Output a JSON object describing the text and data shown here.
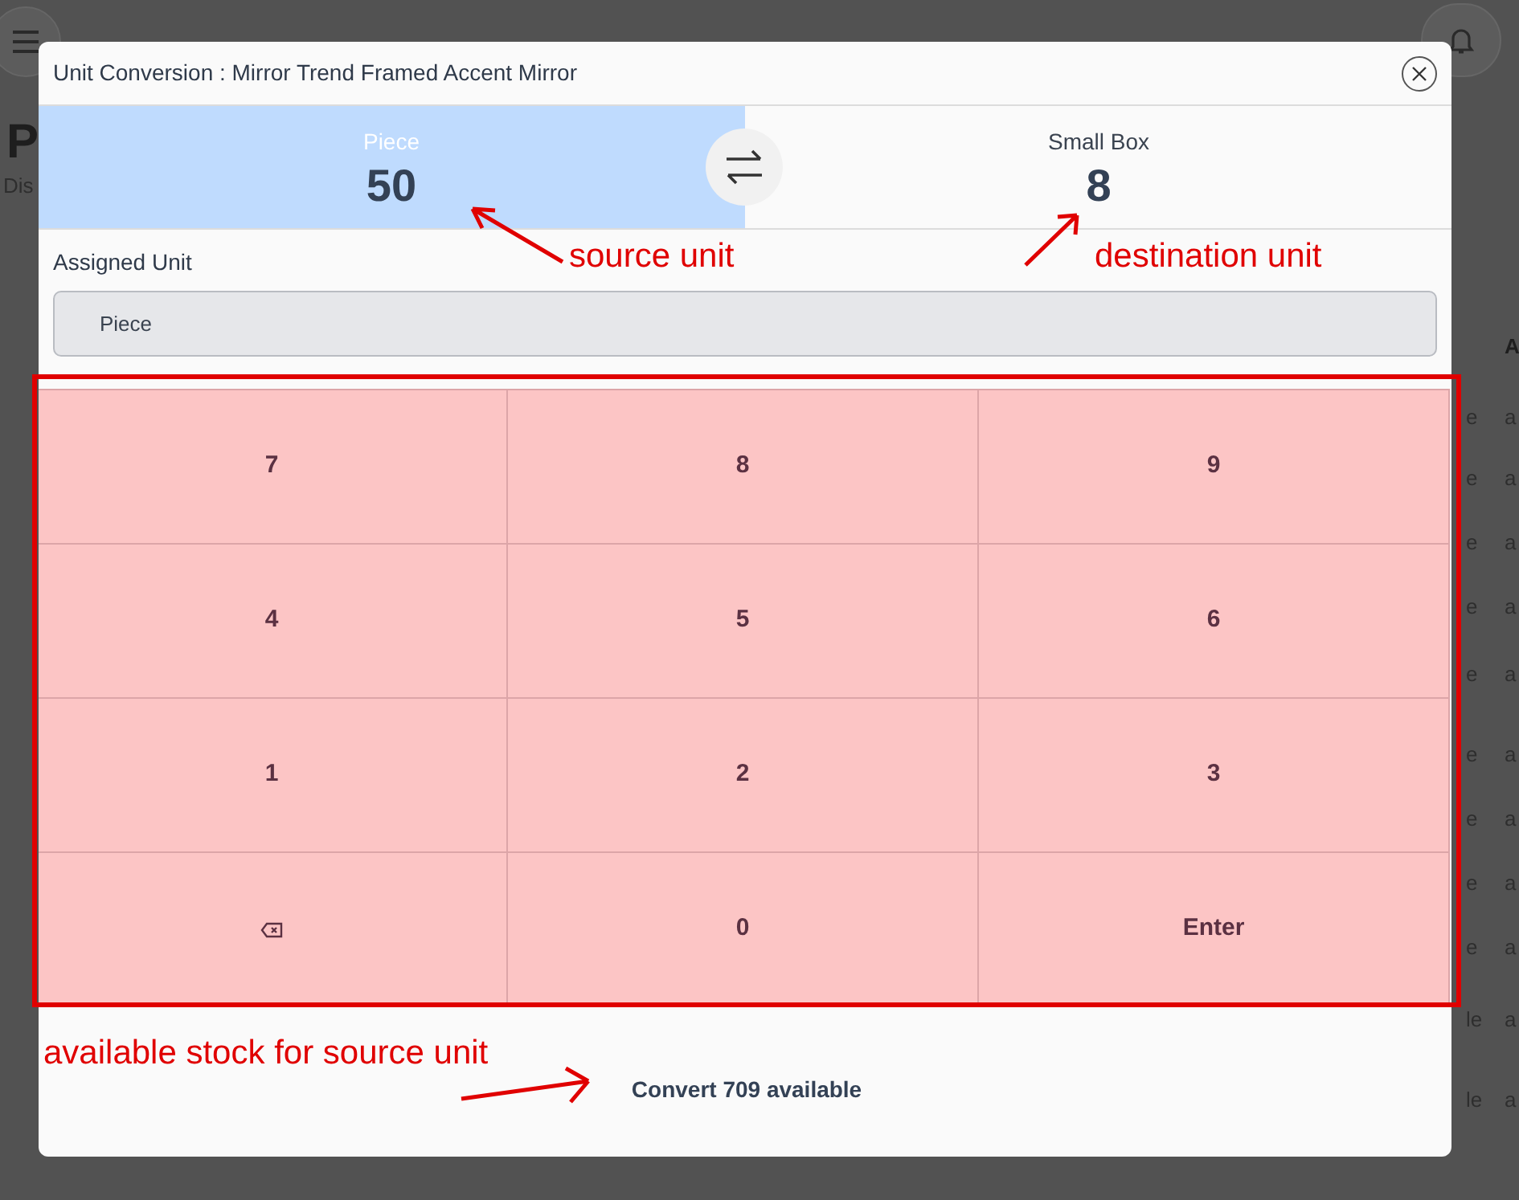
{
  "background_page": {
    "title": "P",
    "subtitle": "Dis",
    "column_header": "A",
    "right_cells": [
      {
        "column_1": "e",
        "column_2": "a"
      },
      {
        "column_1": "e",
        "column_2": "a"
      },
      {
        "column_1": "e",
        "column_2": "a"
      },
      {
        "column_1": "e",
        "column_2": "a"
      },
      {
        "column_1": "e",
        "column_2": "a"
      },
      {
        "column_1": "e",
        "column_2": "a"
      },
      {
        "column_1": "e",
        "column_2": "a"
      },
      {
        "column_1": "e",
        "column_2": "a"
      },
      {
        "column_1": "e",
        "column_2": "a"
      },
      {
        "column_1": "le",
        "column_2": "a"
      },
      {
        "column_1": "le",
        "column_2": "a"
      }
    ]
  },
  "dialog": {
    "title": "Unit Conversion : Mirror Trend Framed Accent Mirror",
    "units": [
      {
        "name": "Piece",
        "value": "50",
        "selected": true
      },
      {
        "name": "Small Box",
        "value": "8",
        "selected": false
      }
    ],
    "assigned_unit": {
      "label": "Assigned Unit",
      "value": "Piece"
    },
    "keypad": [
      {
        "kind": "digit",
        "label": "7"
      },
      {
        "kind": "digit",
        "label": "8"
      },
      {
        "kind": "digit",
        "label": "9"
      },
      {
        "kind": "digit",
        "label": "4"
      },
      {
        "kind": "digit",
        "label": "5"
      },
      {
        "kind": "digit",
        "label": "6"
      },
      {
        "kind": "digit",
        "label": "1"
      },
      {
        "kind": "digit",
        "label": "2"
      },
      {
        "kind": "digit",
        "label": "3"
      },
      {
        "kind": "backspace"
      },
      {
        "kind": "digit",
        "label": "0"
      },
      {
        "kind": "enter",
        "label": "Enter"
      }
    ],
    "footer": "Convert 709 available"
  },
  "annotations": [
    "source unit",
    "destination unit",
    "available stock for source unit"
  ]
}
